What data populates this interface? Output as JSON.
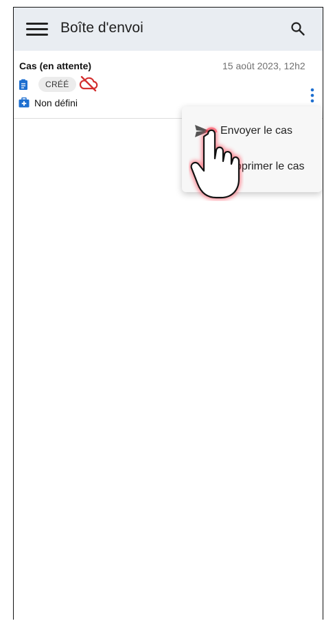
{
  "appbar": {
    "title": "Boîte d'envoi",
    "menu_icon": "hamburger-menu-icon",
    "search_icon": "search-icon"
  },
  "case": {
    "title": "Cas (en attente)",
    "date": "15 août 2023, 12h2",
    "status": "CRÉÉ",
    "type": "Non défini",
    "doc_icon": "clipboard-icon",
    "sync_icon": "cloud-off-icon",
    "type_icon": "medical-kit-icon"
  },
  "popup_menu": {
    "items": [
      {
        "label": "Envoyer le cas",
        "icon": "send-icon"
      },
      {
        "label": "pprimer le cas"
      }
    ]
  },
  "colors": {
    "accent": "#1e6fd0",
    "error": "#d32f2f",
    "appbar": "#e9edf2"
  }
}
